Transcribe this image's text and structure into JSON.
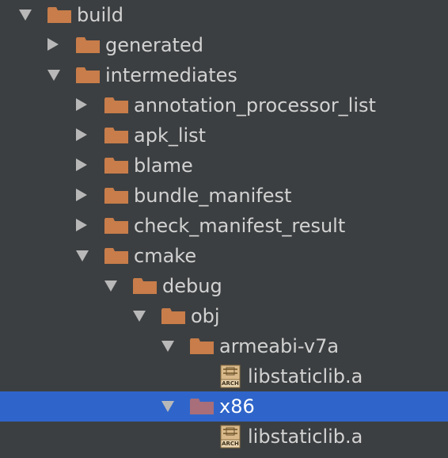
{
  "tree": {
    "items": [
      {
        "label": "build",
        "depth": 0,
        "state": "expanded",
        "icon": "folder-icon",
        "selected": false
      },
      {
        "label": "generated",
        "depth": 1,
        "state": "collapsed",
        "icon": "folder-icon",
        "selected": false
      },
      {
        "label": "intermediates",
        "depth": 1,
        "state": "expanded",
        "icon": "folder-icon",
        "selected": false
      },
      {
        "label": "annotation_processor_list",
        "depth": 2,
        "state": "collapsed",
        "icon": "folder-icon",
        "selected": false
      },
      {
        "label": "apk_list",
        "depth": 2,
        "state": "collapsed",
        "icon": "folder-icon",
        "selected": false
      },
      {
        "label": "blame",
        "depth": 2,
        "state": "collapsed",
        "icon": "folder-icon",
        "selected": false
      },
      {
        "label": "bundle_manifest",
        "depth": 2,
        "state": "collapsed",
        "icon": "folder-icon",
        "selected": false
      },
      {
        "label": "check_manifest_result",
        "depth": 2,
        "state": "collapsed",
        "icon": "folder-icon",
        "selected": false
      },
      {
        "label": "cmake",
        "depth": 2,
        "state": "expanded",
        "icon": "folder-icon",
        "selected": false
      },
      {
        "label": "debug",
        "depth": 3,
        "state": "expanded",
        "icon": "folder-icon",
        "selected": false
      },
      {
        "label": "obj",
        "depth": 4,
        "state": "expanded",
        "icon": "folder-icon",
        "selected": false
      },
      {
        "label": "armeabi-v7a",
        "depth": 5,
        "state": "expanded",
        "icon": "folder-icon",
        "selected": false
      },
      {
        "label": "libstaticlib.a",
        "depth": 6,
        "state": "leaf",
        "icon": "archive-file-icon",
        "selected": false
      },
      {
        "label": "x86",
        "depth": 5,
        "state": "expanded",
        "icon": "folder-icon",
        "selected": true
      },
      {
        "label": "libstaticlib.a",
        "depth": 6,
        "state": "leaf",
        "icon": "archive-file-icon",
        "selected": false
      }
    ],
    "archive_badge": "ARCH"
  },
  "colors": {
    "background": "#3c3f41",
    "selection": "#2f65ca",
    "folder": "#c87d4a",
    "selected_folder": "#a86e7a",
    "text": "#d2d2d2",
    "selected_text": "#ffffff",
    "arrow": "#b8b8b8"
  }
}
